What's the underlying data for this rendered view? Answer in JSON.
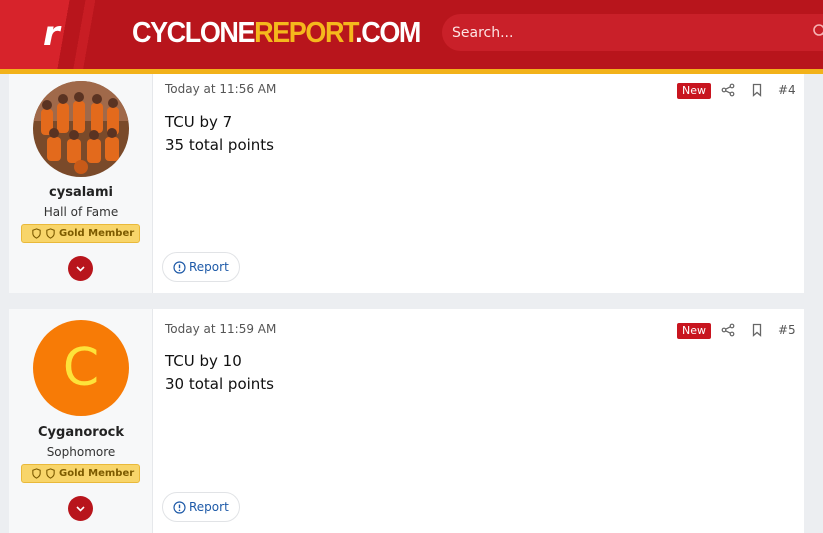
{
  "header": {
    "logo_letter": "r",
    "brand_white": "CYCLONE",
    "brand_yellow": "REPORT",
    "brand_suffix": ".COM",
    "search_placeholder": "Search..."
  },
  "posts": [
    {
      "username": "cysalami",
      "user_title": "Hall of Fame",
      "badge": "Gold Member",
      "time": "Today at 11:56 AM",
      "new_label": "New",
      "post_number": "#4",
      "lines": [
        "TCU by 7",
        "35 total points"
      ],
      "report_label": "Report"
    },
    {
      "username": "Cyganorock",
      "avatar_letter": "C",
      "user_title": "Sophomore",
      "badge": "Gold Member",
      "time": "Today at 11:59 AM",
      "new_label": "New",
      "post_number": "#5",
      "lines": [
        "TCU by 10",
        "30 total points"
      ],
      "report_label": "Report"
    }
  ],
  "colors": {
    "header_red": "#b8151c",
    "gold_bar": "#f2b21a",
    "avatar_orange": "#f77b06",
    "badge_gold": "#f8d56a"
  }
}
